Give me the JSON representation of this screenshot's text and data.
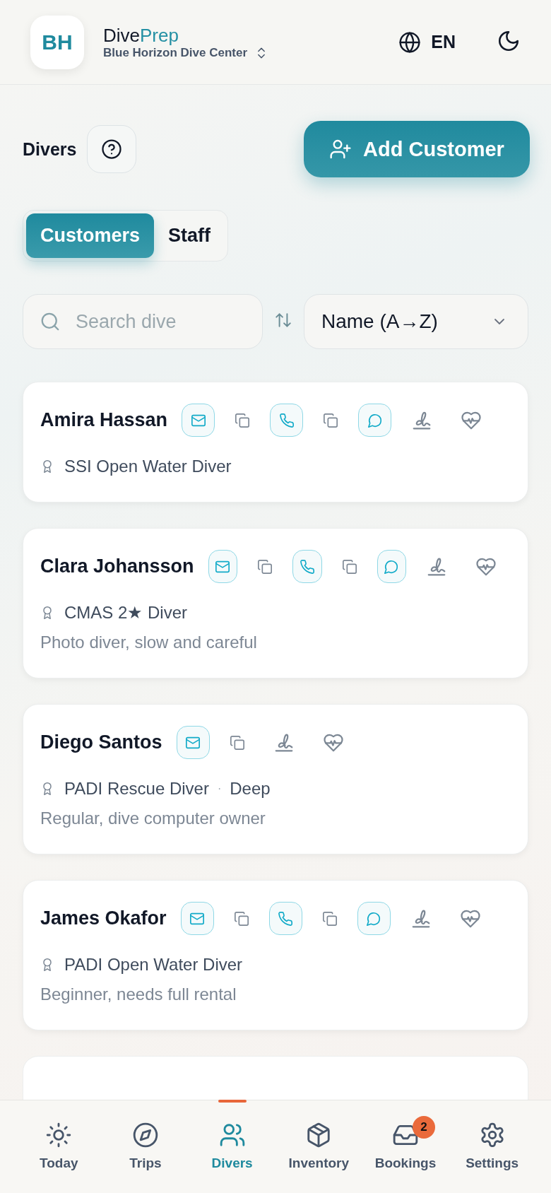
{
  "header": {
    "logo_initials": "BH",
    "app_name": "Dive",
    "app_name_accent": "Prep",
    "center_name": "Blue Horizon Dive Center",
    "language": "EN"
  },
  "page": {
    "title": "Divers",
    "add_button": "Add Customer"
  },
  "tabs": [
    {
      "label": "Customers",
      "selected": true
    },
    {
      "label": "Staff",
      "selected": false
    }
  ],
  "search": {
    "placeholder": "Search dive"
  },
  "sort": {
    "value": "Name (A→Z)"
  },
  "customers": [
    {
      "name": "Amira Hassan",
      "actions": [
        {
          "kind": "email"
        },
        {
          "kind": "copy"
        },
        {
          "kind": "phone"
        },
        {
          "kind": "copy"
        },
        {
          "kind": "chat"
        },
        {
          "kind": "signature"
        },
        {
          "kind": "health"
        }
      ],
      "certification": "SSI Open Water Diver"
    },
    {
      "name": "Clara Johansson",
      "actions": [
        {
          "kind": "email"
        },
        {
          "kind": "copy"
        },
        {
          "kind": "phone"
        },
        {
          "kind": "copy"
        },
        {
          "kind": "chat"
        },
        {
          "kind": "signature"
        },
        {
          "kind": "health"
        }
      ],
      "certification": "CMAS 2★ Diver",
      "note": "Photo diver, slow and careful"
    },
    {
      "name": "Diego Santos",
      "actions": [
        {
          "kind": "email"
        },
        {
          "kind": "copy"
        },
        {
          "kind": "signature"
        },
        {
          "kind": "health"
        }
      ],
      "certification": "PADI Rescue Diver",
      "separator": "·",
      "specialty": "Deep",
      "note": "Regular, dive computer owner"
    },
    {
      "name": "James Okafor",
      "actions": [
        {
          "kind": "email"
        },
        {
          "kind": "copy"
        },
        {
          "kind": "phone"
        },
        {
          "kind": "copy"
        },
        {
          "kind": "chat"
        },
        {
          "kind": "signature"
        },
        {
          "kind": "health"
        }
      ],
      "certification": "PADI Open Water Diver",
      "note": "Beginner, needs full rental"
    }
  ],
  "nav": [
    {
      "label": "Today",
      "selected": false
    },
    {
      "label": "Trips",
      "selected": false
    },
    {
      "label": "Divers",
      "selected": true
    },
    {
      "label": "Inventory",
      "selected": false
    },
    {
      "label": "Bookings",
      "selected": false,
      "badge": "2"
    },
    {
      "label": "Settings",
      "selected": false
    }
  ]
}
